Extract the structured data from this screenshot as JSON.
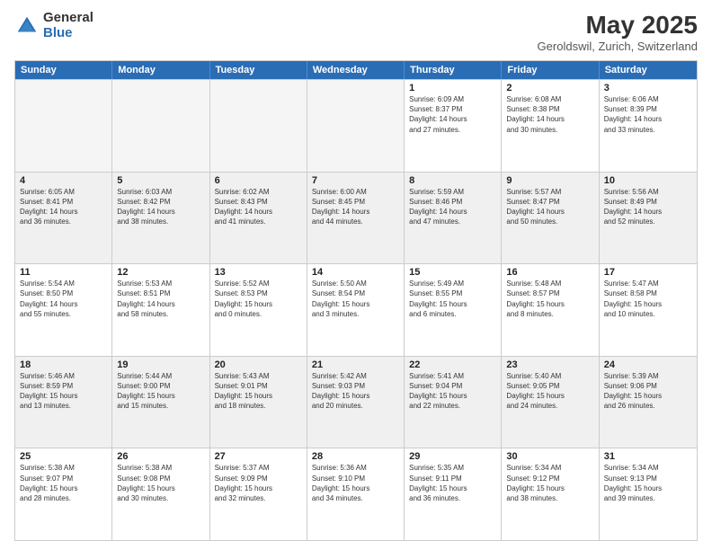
{
  "header": {
    "logo_general": "General",
    "logo_blue": "Blue",
    "title": "May 2025",
    "subtitle": "Geroldswil, Zurich, Switzerland"
  },
  "days_of_week": [
    "Sunday",
    "Monday",
    "Tuesday",
    "Wednesday",
    "Thursday",
    "Friday",
    "Saturday"
  ],
  "weeks": [
    [
      {
        "day": "",
        "info": ""
      },
      {
        "day": "",
        "info": ""
      },
      {
        "day": "",
        "info": ""
      },
      {
        "day": "",
        "info": ""
      },
      {
        "day": "1",
        "info": "Sunrise: 6:09 AM\nSunset: 8:37 PM\nDaylight: 14 hours\nand 27 minutes."
      },
      {
        "day": "2",
        "info": "Sunrise: 6:08 AM\nSunset: 8:38 PM\nDaylight: 14 hours\nand 30 minutes."
      },
      {
        "day": "3",
        "info": "Sunrise: 6:06 AM\nSunset: 8:39 PM\nDaylight: 14 hours\nand 33 minutes."
      }
    ],
    [
      {
        "day": "4",
        "info": "Sunrise: 6:05 AM\nSunset: 8:41 PM\nDaylight: 14 hours\nand 36 minutes."
      },
      {
        "day": "5",
        "info": "Sunrise: 6:03 AM\nSunset: 8:42 PM\nDaylight: 14 hours\nand 38 minutes."
      },
      {
        "day": "6",
        "info": "Sunrise: 6:02 AM\nSunset: 8:43 PM\nDaylight: 14 hours\nand 41 minutes."
      },
      {
        "day": "7",
        "info": "Sunrise: 6:00 AM\nSunset: 8:45 PM\nDaylight: 14 hours\nand 44 minutes."
      },
      {
        "day": "8",
        "info": "Sunrise: 5:59 AM\nSunset: 8:46 PM\nDaylight: 14 hours\nand 47 minutes."
      },
      {
        "day": "9",
        "info": "Sunrise: 5:57 AM\nSunset: 8:47 PM\nDaylight: 14 hours\nand 50 minutes."
      },
      {
        "day": "10",
        "info": "Sunrise: 5:56 AM\nSunset: 8:49 PM\nDaylight: 14 hours\nand 52 minutes."
      }
    ],
    [
      {
        "day": "11",
        "info": "Sunrise: 5:54 AM\nSunset: 8:50 PM\nDaylight: 14 hours\nand 55 minutes."
      },
      {
        "day": "12",
        "info": "Sunrise: 5:53 AM\nSunset: 8:51 PM\nDaylight: 14 hours\nand 58 minutes."
      },
      {
        "day": "13",
        "info": "Sunrise: 5:52 AM\nSunset: 8:53 PM\nDaylight: 15 hours\nand 0 minutes."
      },
      {
        "day": "14",
        "info": "Sunrise: 5:50 AM\nSunset: 8:54 PM\nDaylight: 15 hours\nand 3 minutes."
      },
      {
        "day": "15",
        "info": "Sunrise: 5:49 AM\nSunset: 8:55 PM\nDaylight: 15 hours\nand 6 minutes."
      },
      {
        "day": "16",
        "info": "Sunrise: 5:48 AM\nSunset: 8:57 PM\nDaylight: 15 hours\nand 8 minutes."
      },
      {
        "day": "17",
        "info": "Sunrise: 5:47 AM\nSunset: 8:58 PM\nDaylight: 15 hours\nand 10 minutes."
      }
    ],
    [
      {
        "day": "18",
        "info": "Sunrise: 5:46 AM\nSunset: 8:59 PM\nDaylight: 15 hours\nand 13 minutes."
      },
      {
        "day": "19",
        "info": "Sunrise: 5:44 AM\nSunset: 9:00 PM\nDaylight: 15 hours\nand 15 minutes."
      },
      {
        "day": "20",
        "info": "Sunrise: 5:43 AM\nSunset: 9:01 PM\nDaylight: 15 hours\nand 18 minutes."
      },
      {
        "day": "21",
        "info": "Sunrise: 5:42 AM\nSunset: 9:03 PM\nDaylight: 15 hours\nand 20 minutes."
      },
      {
        "day": "22",
        "info": "Sunrise: 5:41 AM\nSunset: 9:04 PM\nDaylight: 15 hours\nand 22 minutes."
      },
      {
        "day": "23",
        "info": "Sunrise: 5:40 AM\nSunset: 9:05 PM\nDaylight: 15 hours\nand 24 minutes."
      },
      {
        "day": "24",
        "info": "Sunrise: 5:39 AM\nSunset: 9:06 PM\nDaylight: 15 hours\nand 26 minutes."
      }
    ],
    [
      {
        "day": "25",
        "info": "Sunrise: 5:38 AM\nSunset: 9:07 PM\nDaylight: 15 hours\nand 28 minutes."
      },
      {
        "day": "26",
        "info": "Sunrise: 5:38 AM\nSunset: 9:08 PM\nDaylight: 15 hours\nand 30 minutes."
      },
      {
        "day": "27",
        "info": "Sunrise: 5:37 AM\nSunset: 9:09 PM\nDaylight: 15 hours\nand 32 minutes."
      },
      {
        "day": "28",
        "info": "Sunrise: 5:36 AM\nSunset: 9:10 PM\nDaylight: 15 hours\nand 34 minutes."
      },
      {
        "day": "29",
        "info": "Sunrise: 5:35 AM\nSunset: 9:11 PM\nDaylight: 15 hours\nand 36 minutes."
      },
      {
        "day": "30",
        "info": "Sunrise: 5:34 AM\nSunset: 9:12 PM\nDaylight: 15 hours\nand 38 minutes."
      },
      {
        "day": "31",
        "info": "Sunrise: 5:34 AM\nSunset: 9:13 PM\nDaylight: 15 hours\nand 39 minutes."
      }
    ]
  ]
}
